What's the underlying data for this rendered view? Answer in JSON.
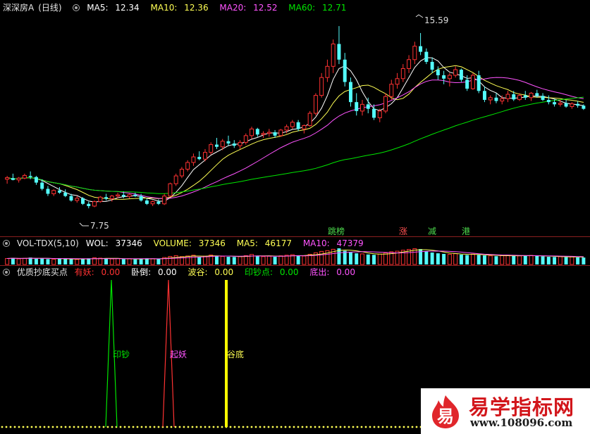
{
  "colors": {
    "up": "#ff3232",
    "down": "#54fcfc",
    "ma5": "#ffffff",
    "ma10": "#ffff54",
    "ma20": "#ff54ff",
    "ma60": "#00e600",
    "sep": "#8a1f1f"
  },
  "price_panel": {
    "stock_name": "深深房A",
    "period": "(日线)",
    "ma5_label": "MA5:",
    "ma5_value": "12.34",
    "ma10_label": "MA10:",
    "ma10_value": "12.36",
    "ma20_label": "MA20:",
    "ma20_value": "12.52",
    "ma60_label": "MA60:",
    "ma60_value": "12.71",
    "high_label": "15.59",
    "low_label": "7.75",
    "signals": [
      {
        "text": "跳榜",
        "color": "#4cd94c",
        "bg": "#0a3a0a"
      },
      {
        "text": "涨",
        "color": "#ff5050",
        "bg": "#3a0a0a"
      },
      {
        "text": "减",
        "color": "#4cd94c",
        "bg": "#0a3a0a"
      },
      {
        "text": "港",
        "color": "#4cd94c",
        "bg": "#0a3a0a"
      }
    ]
  },
  "volume_panel": {
    "title": "VOL-TDX(5,10)",
    "wol_label": "WOL:",
    "wol_value": "37346",
    "volume_label": "VOLUME:",
    "volume_value": "37346",
    "ma5_label": "MA5:",
    "ma5_value": "46177",
    "ma10_label": "MA10:",
    "ma10_value": "47379"
  },
  "indicator_panel": {
    "title": "优质抄底买点",
    "items": [
      {
        "label": "有妖:",
        "value": "0.00",
        "color": "#ff3232"
      },
      {
        "label": "卧倒:",
        "value": "0.00",
        "color": "#ffffff"
      },
      {
        "label": "波谷:",
        "value": "0.00",
        "color": "#ffff54"
      },
      {
        "label": "印钞点:",
        "value": "0.00",
        "color": "#00e600"
      },
      {
        "label": "底出:",
        "value": "0.00",
        "color": "#ff54ff"
      }
    ],
    "markers": [
      {
        "text": "印钞",
        "color": "#00e600"
      },
      {
        "text": "起妖",
        "color": "#ff54ff"
      },
      {
        "text": "谷底",
        "color": "#ffff54"
      }
    ]
  },
  "watermark": {
    "title": "易学指标网",
    "url": "www.108096.com",
    "mark_glyph": "易"
  },
  "chart_data": [
    {
      "type": "candlestick",
      "title": "深深房A (日线)",
      "ylim": [
        7.0,
        16.5
      ],
      "candles": [
        [
          9.05,
          9.2,
          8.85,
          9.12
        ],
        [
          9.1,
          9.3,
          9.0,
          9.02
        ],
        [
          9.02,
          9.15,
          8.9,
          9.1
        ],
        [
          9.1,
          9.3,
          9.05,
          9.22
        ],
        [
          9.2,
          9.4,
          9.05,
          9.15
        ],
        [
          9.15,
          9.2,
          8.8,
          8.9
        ],
        [
          8.9,
          9.05,
          8.55,
          8.62
        ],
        [
          8.62,
          8.75,
          8.3,
          8.4
        ],
        [
          8.4,
          8.6,
          8.3,
          8.55
        ],
        [
          8.55,
          8.7,
          8.4,
          8.45
        ],
        [
          8.45,
          8.6,
          8.25,
          8.3
        ],
        [
          8.3,
          8.4,
          8.05,
          8.1
        ],
        [
          8.1,
          8.3,
          8.0,
          8.2
        ],
        [
          8.2,
          8.25,
          7.9,
          7.95
        ],
        [
          7.95,
          8.05,
          7.75,
          7.85
        ],
        [
          7.85,
          8.1,
          7.8,
          8.05
        ],
        [
          8.05,
          8.3,
          8.0,
          8.25
        ],
        [
          8.25,
          8.4,
          8.1,
          8.18
        ],
        [
          8.18,
          8.35,
          8.05,
          8.3
        ],
        [
          8.3,
          8.45,
          8.2,
          8.35
        ],
        [
          8.35,
          8.5,
          8.2,
          8.28
        ],
        [
          8.28,
          8.4,
          8.2,
          8.36
        ],
        [
          8.36,
          8.45,
          8.25,
          8.3
        ],
        [
          8.3,
          8.4,
          8.05,
          8.1
        ],
        [
          8.1,
          8.2,
          7.9,
          7.95
        ],
        [
          7.95,
          8.1,
          7.85,
          8.05
        ],
        [
          8.05,
          8.15,
          7.9,
          7.95
        ],
        [
          7.95,
          8.4,
          7.9,
          8.3
        ],
        [
          8.3,
          8.9,
          8.25,
          8.85
        ],
        [
          8.85,
          9.3,
          8.75,
          9.2
        ],
        [
          9.2,
          9.6,
          9.1,
          9.5
        ],
        [
          9.5,
          9.9,
          9.4,
          9.8
        ],
        [
          9.8,
          10.2,
          9.65,
          10.05
        ],
        [
          10.05,
          10.3,
          9.9,
          9.95
        ],
        [
          9.95,
          10.4,
          9.85,
          10.25
        ],
        [
          10.25,
          10.7,
          10.15,
          10.6
        ],
        [
          10.6,
          10.9,
          10.4,
          10.5
        ],
        [
          10.5,
          10.85,
          10.35,
          10.75
        ],
        [
          10.75,
          11.0,
          10.55,
          10.65
        ],
        [
          10.65,
          10.8,
          10.45,
          10.55
        ],
        [
          10.55,
          10.8,
          10.4,
          10.7
        ],
        [
          10.7,
          11.1,
          10.6,
          11.0
        ],
        [
          11.0,
          11.4,
          10.85,
          11.3
        ],
        [
          11.3,
          11.35,
          10.95,
          11.05
        ],
        [
          11.05,
          11.2,
          10.9,
          11.1
        ],
        [
          11.1,
          11.3,
          10.95,
          11.15
        ],
        [
          11.15,
          11.25,
          10.9,
          11.0
        ],
        [
          11.0,
          11.3,
          10.95,
          11.25
        ],
        [
          11.25,
          11.5,
          11.1,
          11.4
        ],
        [
          11.4,
          11.7,
          11.3,
          11.6
        ],
        [
          11.6,
          11.7,
          11.2,
          11.3
        ],
        [
          11.3,
          11.5,
          11.1,
          11.45
        ],
        [
          11.45,
          12.1,
          11.4,
          12.0
        ],
        [
          12.0,
          12.9,
          11.9,
          12.8
        ],
        [
          12.8,
          13.8,
          12.7,
          13.6
        ],
        [
          13.6,
          14.4,
          13.4,
          14.1
        ],
        [
          14.1,
          15.3,
          13.8,
          15.1
        ],
        [
          15.1,
          15.9,
          14.2,
          14.4
        ],
        [
          14.4,
          14.7,
          13.2,
          13.4
        ],
        [
          13.4,
          13.6,
          12.3,
          12.5
        ],
        [
          12.5,
          12.9,
          11.9,
          12.1
        ],
        [
          12.1,
          12.6,
          11.9,
          12.4
        ],
        [
          12.4,
          12.7,
          12.0,
          12.2
        ],
        [
          12.2,
          12.4,
          11.7,
          11.8
        ],
        [
          11.8,
          12.2,
          11.6,
          12.1
        ],
        [
          12.1,
          12.9,
          12.0,
          12.75
        ],
        [
          12.75,
          13.5,
          12.6,
          13.3
        ],
        [
          13.3,
          13.8,
          13.1,
          13.55
        ],
        [
          13.55,
          14.2,
          13.4,
          14.0
        ],
        [
          14.0,
          14.6,
          13.8,
          14.4
        ],
        [
          14.4,
          15.2,
          14.2,
          15.0
        ],
        [
          15.0,
          15.59,
          14.6,
          14.75
        ],
        [
          14.75,
          14.9,
          14.2,
          14.3
        ],
        [
          14.3,
          14.5,
          13.8,
          13.95
        ],
        [
          13.95,
          14.1,
          13.5,
          13.7
        ],
        [
          13.7,
          13.9,
          13.3,
          13.55
        ],
        [
          13.55,
          13.8,
          13.2,
          13.7
        ],
        [
          13.7,
          14.1,
          13.6,
          13.95
        ],
        [
          13.95,
          14.0,
          13.4,
          13.5
        ],
        [
          13.5,
          13.7,
          13.0,
          13.1
        ],
        [
          13.1,
          13.8,
          13.05,
          13.7
        ],
        [
          13.7,
          13.9,
          12.9,
          13.0
        ],
        [
          13.0,
          13.2,
          12.5,
          12.6
        ],
        [
          12.6,
          12.8,
          12.4,
          12.7
        ],
        [
          12.7,
          12.9,
          12.45,
          12.55
        ],
        [
          12.55,
          12.8,
          12.4,
          12.65
        ],
        [
          12.65,
          13.0,
          12.5,
          12.85
        ],
        [
          12.85,
          13.0,
          12.55,
          12.62
        ],
        [
          12.62,
          12.9,
          12.55,
          12.8
        ],
        [
          12.8,
          13.0,
          12.6,
          12.7
        ],
        [
          12.7,
          12.95,
          12.55,
          12.9
        ],
        [
          12.9,
          13.05,
          12.7,
          12.78
        ],
        [
          12.78,
          12.9,
          12.55,
          12.6
        ],
        [
          12.6,
          12.8,
          12.4,
          12.5
        ],
        [
          12.5,
          12.65,
          12.3,
          12.4
        ],
        [
          12.4,
          12.6,
          12.3,
          12.45
        ],
        [
          12.45,
          12.6,
          12.25,
          12.3
        ],
        [
          12.3,
          12.5,
          12.2,
          12.42
        ],
        [
          12.42,
          12.55,
          12.25,
          12.34
        ],
        [
          12.34,
          12.4,
          12.15,
          12.2
        ]
      ],
      "volumes": [
        3.1,
        3.4,
        2.9,
        3.2,
        3.6,
        3.0,
        3.3,
        2.8,
        2.7,
        3.1,
        2.9,
        3.0,
        2.6,
        2.8,
        3.2,
        3.5,
        3.3,
        3.0,
        2.9,
        3.1,
        2.8,
        3.0,
        2.7,
        2.9,
        3.2,
        3.0,
        2.8,
        3.6,
        4.2,
        4.6,
        4.1,
        4.4,
        4.8,
        4.0,
        4.3,
        4.9,
        4.5,
        4.2,
        4.0,
        3.9,
        4.1,
        4.6,
        5.2,
        4.4,
        4.1,
        4.3,
        4.0,
        4.5,
        4.8,
        5.1,
        4.6,
        4.4,
        5.3,
        6.1,
        6.8,
        7.2,
        7.9,
        8.4,
        7.1,
        6.3,
        5.8,
        5.5,
        5.2,
        5.0,
        5.4,
        6.0,
        6.6,
        6.9,
        7.4,
        7.8,
        8.2,
        8.0,
        6.9,
        6.2,
        5.8,
        5.5,
        5.3,
        5.6,
        5.1,
        4.9,
        5.4,
        5.0,
        4.7,
        4.5,
        4.3,
        4.6,
        4.8,
        4.4,
        4.5,
        4.6,
        4.7,
        4.4,
        4.2,
        4.0,
        3.9,
        4.1,
        3.8,
        4.0,
        3.7,
        3.6
      ]
    },
    {
      "type": "line",
      "title": "优质抄底买点",
      "series": [
        {
          "name": "印钞点",
          "spike_index": 20,
          "value": 1.0
        },
        {
          "name": "有妖",
          "spike_index": 30,
          "value": 1.0
        },
        {
          "name": "波谷",
          "spike_index": 40,
          "value": 1.0
        }
      ]
    }
  ]
}
